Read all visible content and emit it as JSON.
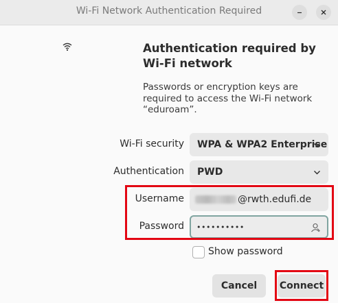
{
  "window": {
    "title": "Wi-Fi Network Authentication Required",
    "minimize_icon": "minimize-icon",
    "close_icon": "close-icon"
  },
  "header": {
    "icon": "wifi-icon",
    "heading": "Authentication required by Wi-Fi network",
    "description": "Passwords or encryption keys are required to access the Wi-Fi network “eduroam”."
  },
  "form": {
    "security": {
      "label": "Wi-Fi security",
      "value": "WPA & WPA2 Enterprise",
      "icon": "chevron-down-icon"
    },
    "authentication": {
      "label": "Authentication",
      "value": "PWD",
      "icon": "chevron-down-icon"
    },
    "username": {
      "label": "Username",
      "value_visible_suffix": "@rwth.edufi.de"
    },
    "password": {
      "label": "Password",
      "masked_value": "••••••••••",
      "icon": "user-icon"
    },
    "show_password": {
      "label": "Show password",
      "checked": false
    }
  },
  "actions": {
    "cancel_label": "Cancel",
    "connect_label": "Connect"
  },
  "colors": {
    "highlight": "#e30613",
    "focus_border": "#7fa4a0",
    "field_bg": "#e8e8e8"
  }
}
